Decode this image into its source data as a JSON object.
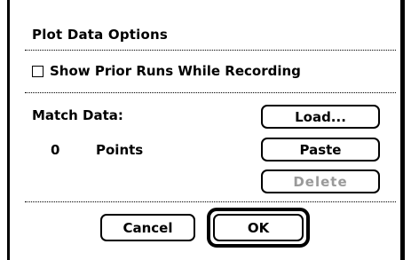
{
  "dialog": {
    "title": "Plot Data Options",
    "show_prior_label": "Show Prior Runs While Recording",
    "show_prior_checked": false,
    "match_data_label": "Match Data:",
    "points_count": "0",
    "points_label": "Points",
    "load_label": "Load...",
    "paste_label": "Paste",
    "delete_label": "Delete",
    "cancel_label": "Cancel",
    "ok_label": "OK"
  }
}
